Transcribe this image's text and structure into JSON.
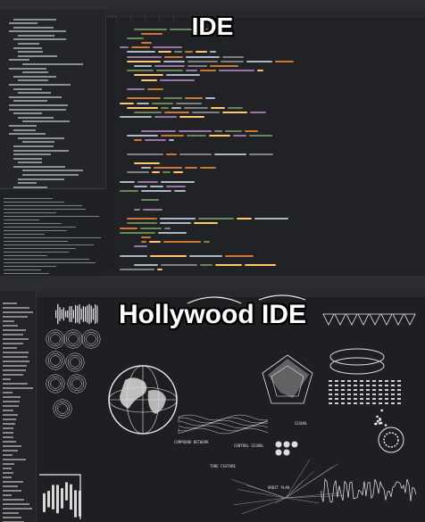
{
  "captions": {
    "top": "IDE",
    "bottom": "Hollywood IDE"
  },
  "hud_labels": {
    "compound_network": "COMPOUND NETWORK",
    "tone_feature": "TONE FEATURE",
    "control_signal": "CONTROL SIGNAL",
    "signal": "SIGNAL",
    "orbit_plan": "ORBIT PLAN"
  },
  "colors": {
    "accent_keyword": "#cc7832",
    "accent_string": "#6a8759",
    "accent_func": "#ffc66d",
    "accent_type": "#9876aa",
    "hud": "#e8e8e8"
  }
}
